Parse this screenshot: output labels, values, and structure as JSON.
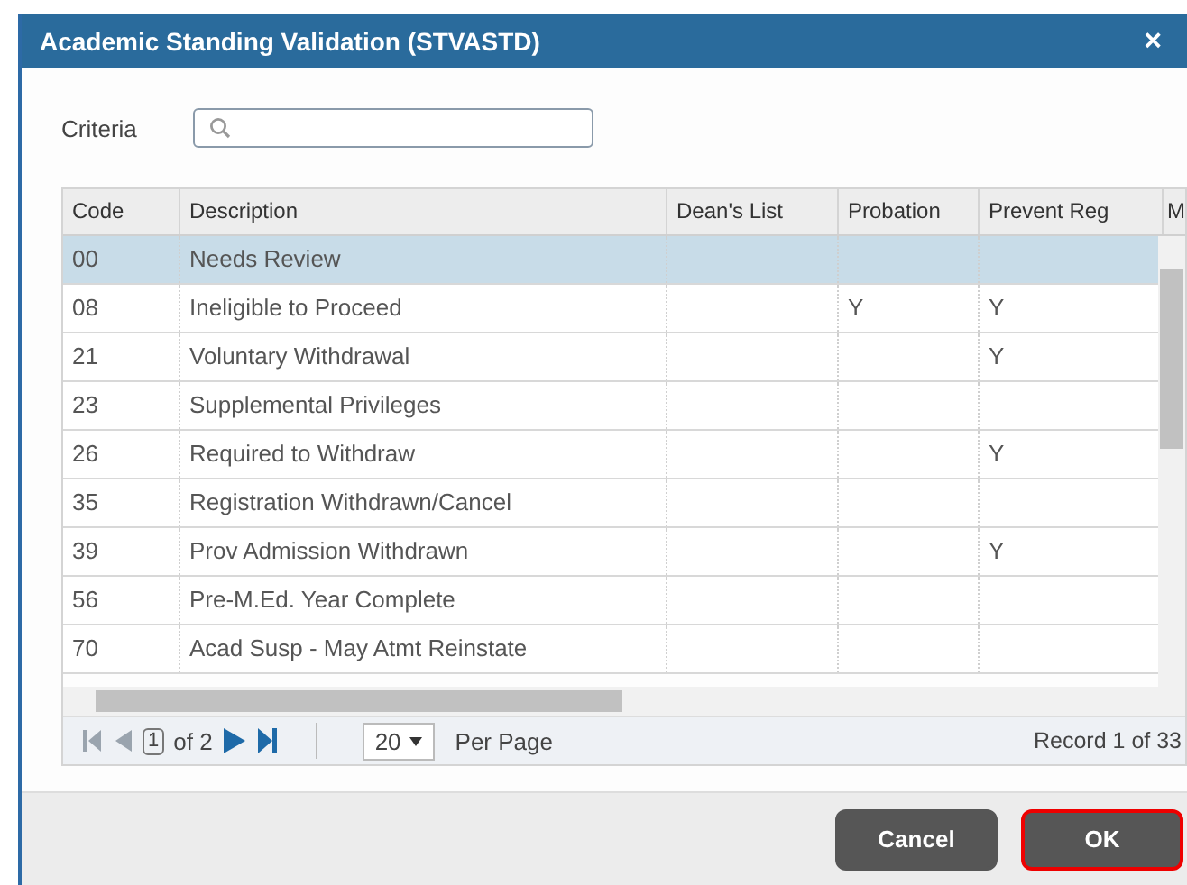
{
  "window": {
    "title": "Academic Standing Validation (STVASTD)",
    "close": "×"
  },
  "criteria": {
    "label": "Criteria"
  },
  "table": {
    "columns": [
      "Code",
      "Description",
      "Dean's List",
      "Probation",
      "Prevent Reg",
      "M"
    ],
    "rows": [
      {
        "cells": [
          "00",
          "Needs Review",
          "",
          "",
          "",
          ""
        ],
        "selected": true
      },
      {
        "cells": [
          "08",
          "Ineligible to Proceed",
          "",
          "Y",
          "Y",
          ""
        ],
        "selected": false
      },
      {
        "cells": [
          "21",
          "Voluntary Withdrawal",
          "",
          "",
          "Y",
          ""
        ],
        "selected": false
      },
      {
        "cells": [
          "23",
          "Supplemental Privileges",
          "",
          "",
          "",
          ""
        ],
        "selected": false
      },
      {
        "cells": [
          "26",
          "Required to Withdraw",
          "",
          "",
          "Y",
          ""
        ],
        "selected": false
      },
      {
        "cells": [
          "35",
          "Registration Withdrawn/Cancel",
          "",
          "",
          "",
          ""
        ],
        "selected": false
      },
      {
        "cells": [
          "39",
          "Prov Admission Withdrawn",
          "",
          "",
          "Y",
          ""
        ],
        "selected": false
      },
      {
        "cells": [
          "56",
          "Pre-M.Ed. Year Complete",
          "",
          "",
          "",
          ""
        ],
        "selected": false
      },
      {
        "cells": [
          "70",
          "Acad Susp - May Atmt Reinstate",
          "",
          "",
          "",
          ""
        ],
        "selected": false
      }
    ]
  },
  "pager": {
    "page": "1",
    "of": "of 2",
    "per_page": "20",
    "per_page_label": "Per Page",
    "record": "Record 1 of 33"
  },
  "buttons": [
    {
      "label": "Cancel",
      "focused": false
    },
    {
      "label": "OK",
      "focused": true
    }
  ]
}
